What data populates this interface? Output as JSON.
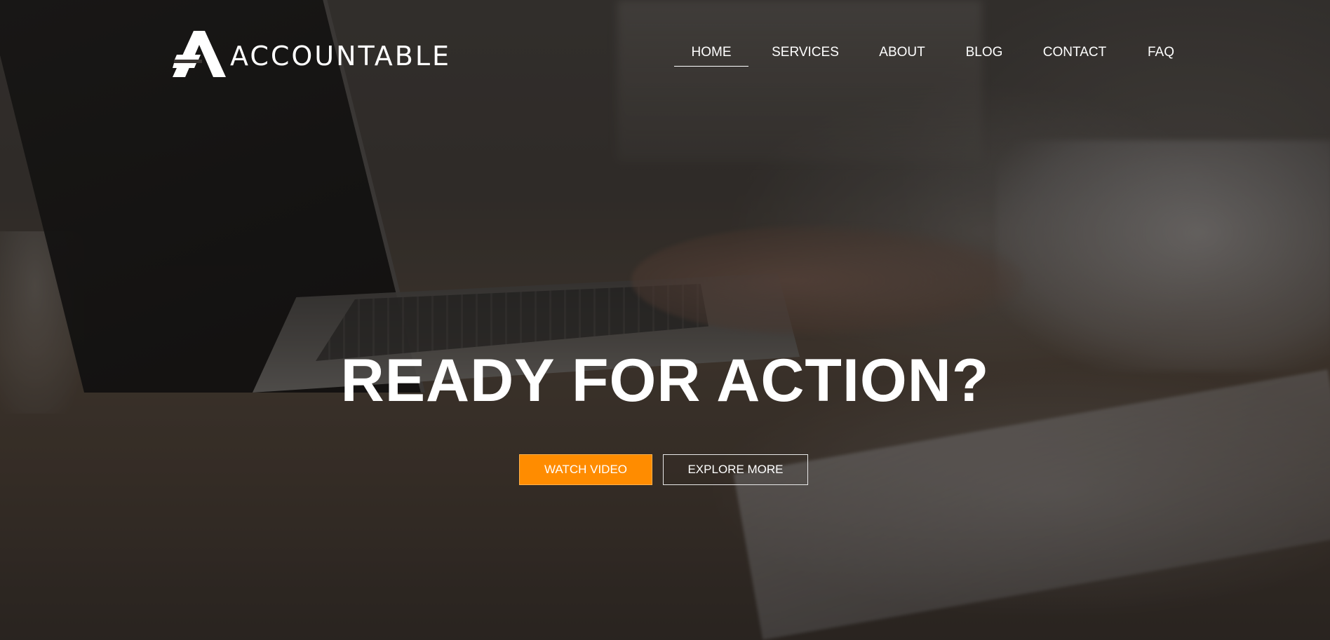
{
  "brand": {
    "name": "ACCOUNTABLE",
    "logo_icon": "accountable-a-logo-icon"
  },
  "nav": {
    "items": [
      {
        "label": "HOME",
        "active": true
      },
      {
        "label": "SERVICES",
        "active": false
      },
      {
        "label": "ABOUT",
        "active": false
      },
      {
        "label": "BLOG",
        "active": false
      },
      {
        "label": "CONTACT",
        "active": false
      },
      {
        "label": "FAQ",
        "active": false
      }
    ]
  },
  "hero": {
    "headline": "READY FOR ACTION?",
    "primary_button": "WATCH VIDEO",
    "secondary_button": "EXPLORE MORE"
  },
  "colors": {
    "accent": "#ff8c00",
    "text": "#ffffff",
    "overlay": "#1a1715"
  }
}
